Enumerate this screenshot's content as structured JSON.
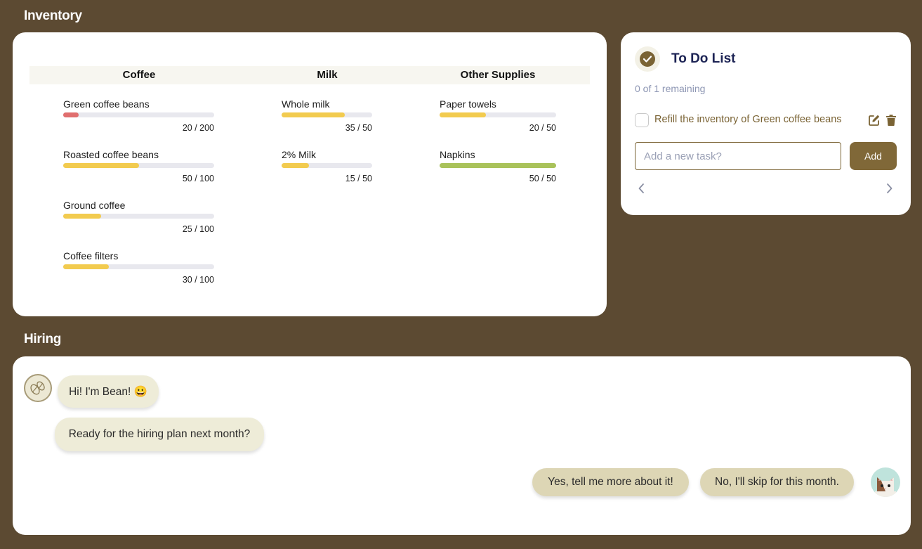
{
  "inventory": {
    "title": "Inventory",
    "columns": [
      "Coffee",
      "Milk",
      "Other Supplies"
    ],
    "items": [
      {
        "name": "Green coffee beans",
        "current": 20,
        "max": 200,
        "qty_label": "20 / 200",
        "bar_color": "#e06e6e"
      },
      {
        "name": "Roasted coffee beans",
        "current": 50,
        "max": 100,
        "qty_label": "50 / 100",
        "bar_color": "#f2cb4f"
      },
      {
        "name": "Ground coffee",
        "current": 25,
        "max": 100,
        "qty_label": "25 / 100",
        "bar_color": "#f2cb4f"
      },
      {
        "name": "Coffee filters",
        "current": 30,
        "max": 100,
        "qty_label": "30 / 100",
        "bar_color": "#f2cb4f"
      },
      {
        "name": "Whole milk",
        "current": 35,
        "max": 50,
        "qty_label": "35 / 50",
        "bar_color": "#f2cb4f"
      },
      {
        "name": "2% Milk",
        "current": 15,
        "max": 50,
        "qty_label": "15 / 50",
        "bar_color": "#f2cb4f"
      },
      {
        "name": "Paper towels",
        "current": 20,
        "max": 50,
        "qty_label": "20 / 50",
        "bar_color": "#f2cb4f"
      },
      {
        "name": "Napkins",
        "current": 50,
        "max": 50,
        "qty_label": "50 / 50",
        "bar_color": "#a9c25a"
      }
    ]
  },
  "todo": {
    "title": "To Do List",
    "remaining": "0 of 1 remaining",
    "task": "Refill the inventory of Green coffee beans",
    "placeholder": "Add a new task?",
    "add_label": "Add"
  },
  "hiring": {
    "title": "Hiring",
    "bot_messages": [
      "Hi! I'm Bean! 😀",
      "Ready for the hiring plan next month?"
    ],
    "replies": [
      "Yes, tell me more about it!",
      "No, I'll skip for this month."
    ]
  },
  "colors": {
    "background": "#5c4a32",
    "accent": "#806838",
    "low_stock": "#e06e6e",
    "mid_stock": "#f2cb4f",
    "full_stock": "#a9c25a"
  }
}
